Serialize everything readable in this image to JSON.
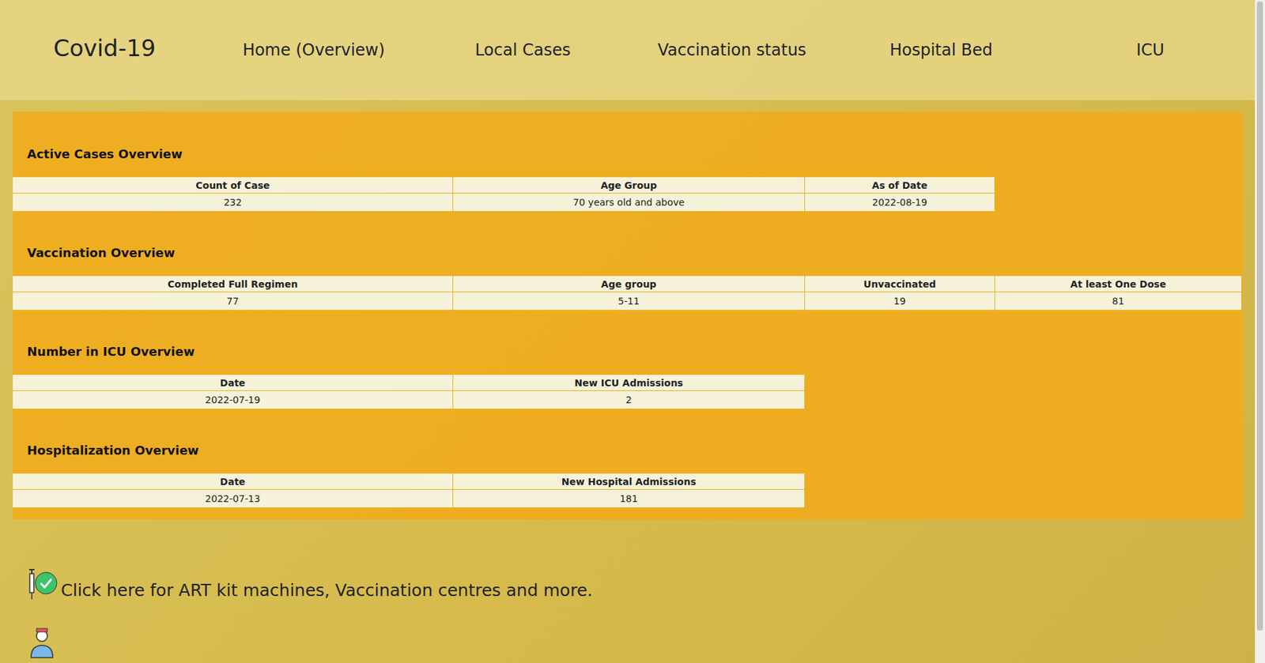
{
  "header": {
    "title": "Covid-19",
    "nav": [
      {
        "label": "Home (Overview)"
      },
      {
        "label": "Local Cases"
      },
      {
        "label": "Vaccination status"
      },
      {
        "label": "Hospital Bed"
      },
      {
        "label": "ICU"
      }
    ]
  },
  "sections": [
    {
      "heading": "Active Cases Overview",
      "columns": [
        "Count of Case",
        "Age Group",
        "As of Date"
      ],
      "rows": [
        [
          "232",
          "70 years old and above",
          "2022-08-19"
        ]
      ]
    },
    {
      "heading": "Vaccination Overview",
      "columns": [
        "Completed Full Regimen",
        "Age group",
        "Unvaccinated",
        "At least One Dose"
      ],
      "rows": [
        [
          "77",
          "5-11",
          "19",
          "81"
        ]
      ]
    },
    {
      "heading": "Number in ICU Overview",
      "columns": [
        "Date",
        "New ICU Admissions"
      ],
      "rows": [
        [
          "2022-07-19",
          "2"
        ]
      ]
    },
    {
      "heading": "Hospitalization Overview",
      "columns": [
        "Date",
        "New Hospital Admissions"
      ],
      "rows": [
        [
          "2022-07-13",
          "181"
        ]
      ]
    }
  ],
  "links": [
    {
      "text": "Click here for ART kit machines, Vaccination centres and more.",
      "kind": "vaccine"
    },
    {
      "text": "",
      "kind": "doctor"
    }
  ]
}
